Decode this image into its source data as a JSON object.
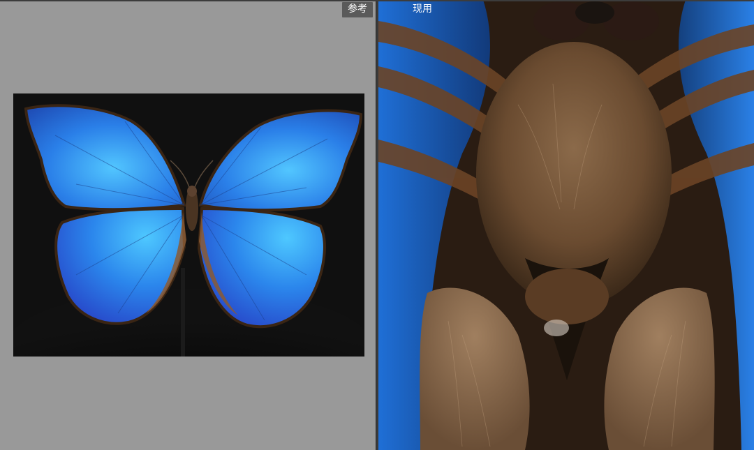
{
  "panes": {
    "reference": {
      "label": "参考",
      "image_subject": "butterfly-specimen-full"
    },
    "current": {
      "label": "现用",
      "image_subject": "butterfly-body-closeup"
    }
  },
  "colors": {
    "ref_background": "#999999",
    "photo_background": "#0e0e0e",
    "wing_blue": "#2f8cf0",
    "wing_edge": "#3a2514",
    "body_brown": "#6b4a2e"
  }
}
